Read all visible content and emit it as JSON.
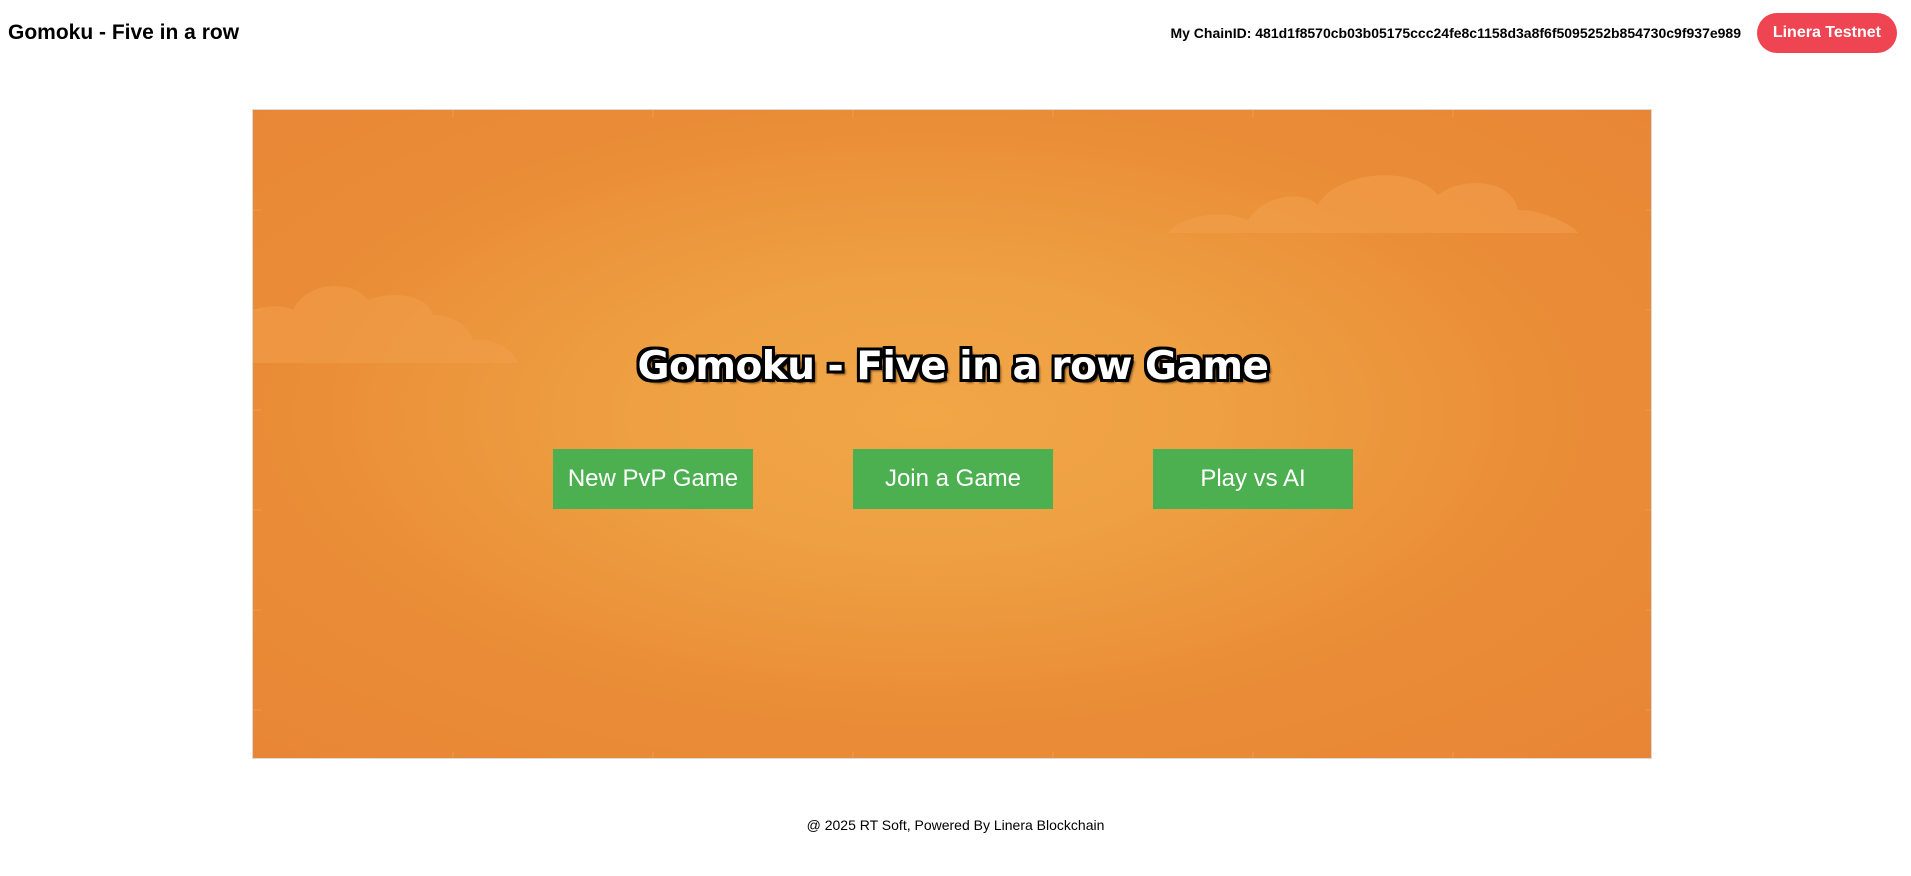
{
  "header": {
    "title": "Gomoku - Five in a row",
    "chain_id_text": "My ChainID: 481d1f8570cb03b05175ccc24fe8c1158d3a8f6f5095252b854730c9f937e989",
    "network_button": "Linera Testnet"
  },
  "game": {
    "title": "Gomoku - Five in a row Game",
    "buttons": {
      "new_pvp": "New PvP Game",
      "join": "Join a Game",
      "play_ai": "Play vs AI"
    }
  },
  "footer": {
    "text": "@ 2025 RT Soft, Powered By Linera Blockchain"
  },
  "colors": {
    "network_button": "#ef4452",
    "menu_button": "#4caf50",
    "stage_background": "#ea8d37"
  }
}
